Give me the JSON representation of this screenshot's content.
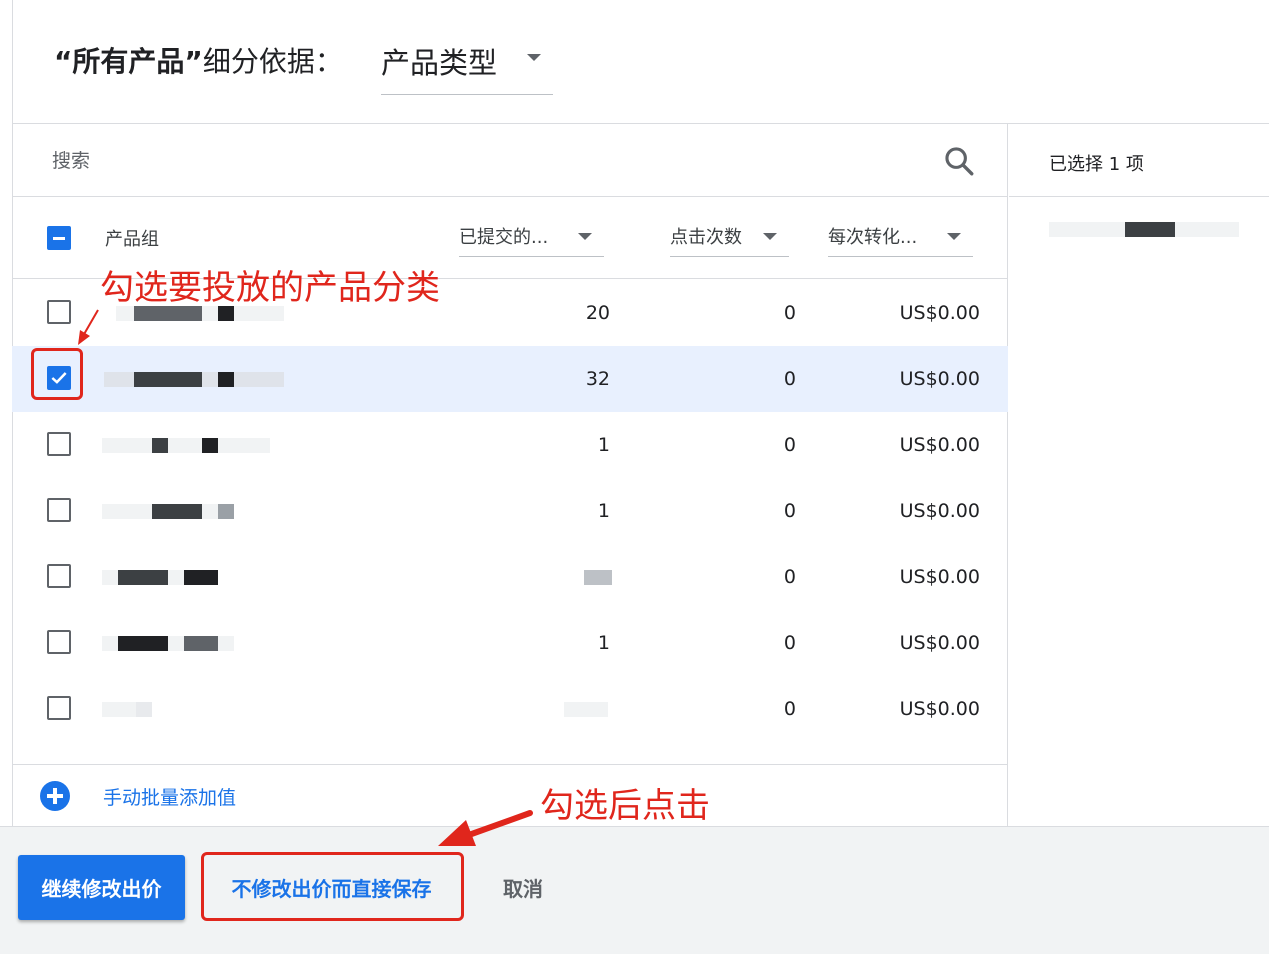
{
  "header": {
    "title_quote": "“所有产品”",
    "title_suffix": "细分依据：",
    "dimension_value": "产品类型"
  },
  "search": {
    "placeholder": "搜索"
  },
  "table": {
    "headers": {
      "product_group": "产品组",
      "submitted": "已提交的...",
      "clicks": "点击次数",
      "cost_per_conv": "每次转化..."
    },
    "rows": [
      {
        "submitted": "20",
        "clicks": "0",
        "cost": "US$0.00",
        "selected": false
      },
      {
        "submitted": "32",
        "clicks": "0",
        "cost": "US$0.00",
        "selected": true
      },
      {
        "submitted": "1",
        "clicks": "0",
        "cost": "US$0.00",
        "selected": false
      },
      {
        "submitted": "1",
        "clicks": "0",
        "cost": "US$0.00",
        "selected": false
      },
      {
        "submitted": "",
        "clicks": "0",
        "cost": "US$0.00",
        "selected": false
      },
      {
        "submitted": "1",
        "clicks": "0",
        "cost": "US$0.00",
        "selected": false
      },
      {
        "submitted": "",
        "clicks": "0",
        "cost": "US$0.00",
        "selected": false
      }
    ]
  },
  "add_values_label": "手动批量添加值",
  "selection": {
    "count_label": "已选择 1 项"
  },
  "actions": {
    "continue_label": "继续修改出价",
    "save_label": "不修改出价而直接保存",
    "cancel_label": "取消"
  },
  "annotations": {
    "select_hint": "勾选要投放的产品分类",
    "click_hint": "勾选后点击",
    "color": "#e0261c"
  },
  "colors": {
    "accent": "#1a73e8",
    "selected_row": "#e8f0fe"
  }
}
